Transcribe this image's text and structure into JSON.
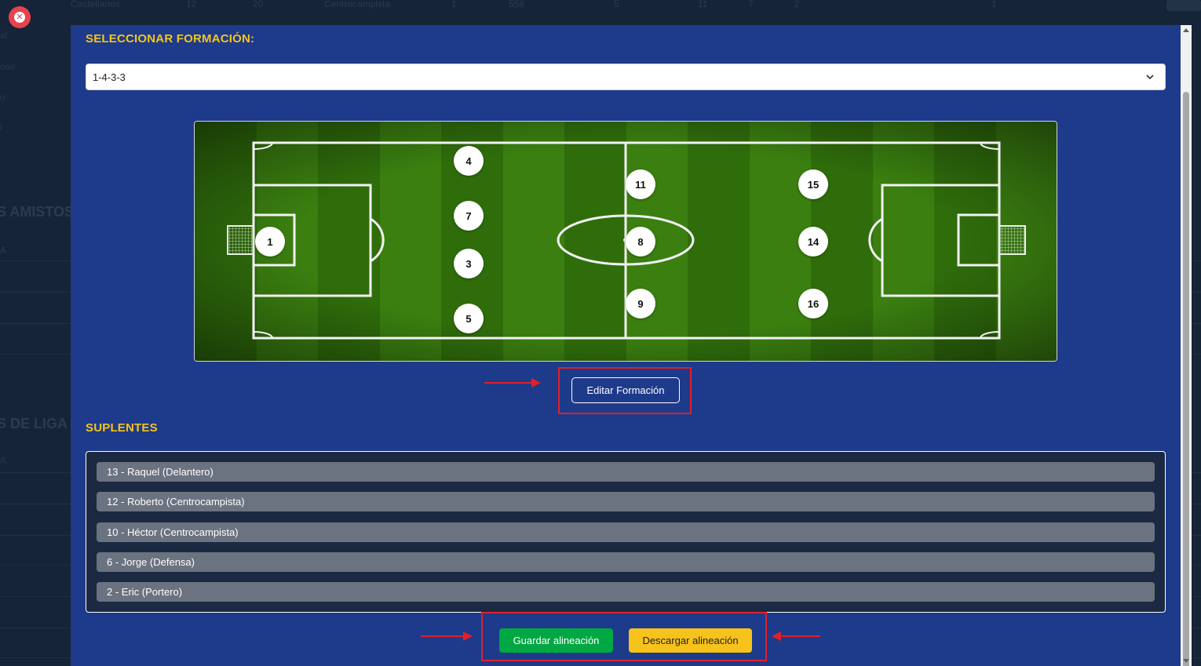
{
  "background": {
    "top_row_cells": [
      "Castellanos",
      "12",
      "20",
      "Centrocampista",
      "1",
      "556",
      "5",
      "11",
      "7",
      "2",
      "1"
    ],
    "left_text_fragments": [
      "al",
      "ose",
      "o",
      "i"
    ],
    "left_headings": [
      "S AMISTOS",
      "S DE LIGA"
    ],
    "left_fragments_small": [
      "A",
      "A"
    ]
  },
  "close_button": {
    "glyph": "✕"
  },
  "formation": {
    "title": "SELECCIONAR FORMACIÓN:",
    "selected_value": "1-4-3-3"
  },
  "pitch": {
    "players": [
      "1",
      "4",
      "7",
      "3",
      "5",
      "11",
      "8",
      "9",
      "15",
      "14",
      "16"
    ]
  },
  "edit_button_label": "Editar Formación",
  "substitutes": {
    "title": "SUPLENTES",
    "items": [
      "13 - Raquel (Delantero)",
      "12 - Roberto (Centrocampista)",
      "10 - Héctor (Centrocampista)",
      "6 - Jorge (Defensa)",
      "2 - Eric (Portero)"
    ]
  },
  "actions": {
    "save_label": "Guardar alineación",
    "download_label": "Descargar alineación"
  },
  "colors": {
    "modal_bg": "#1e3a8a",
    "title_yellow": "#f5c518",
    "save_green": "#00a843",
    "download_yellow": "#f7c31a",
    "annotation_red": "#e0202a"
  }
}
